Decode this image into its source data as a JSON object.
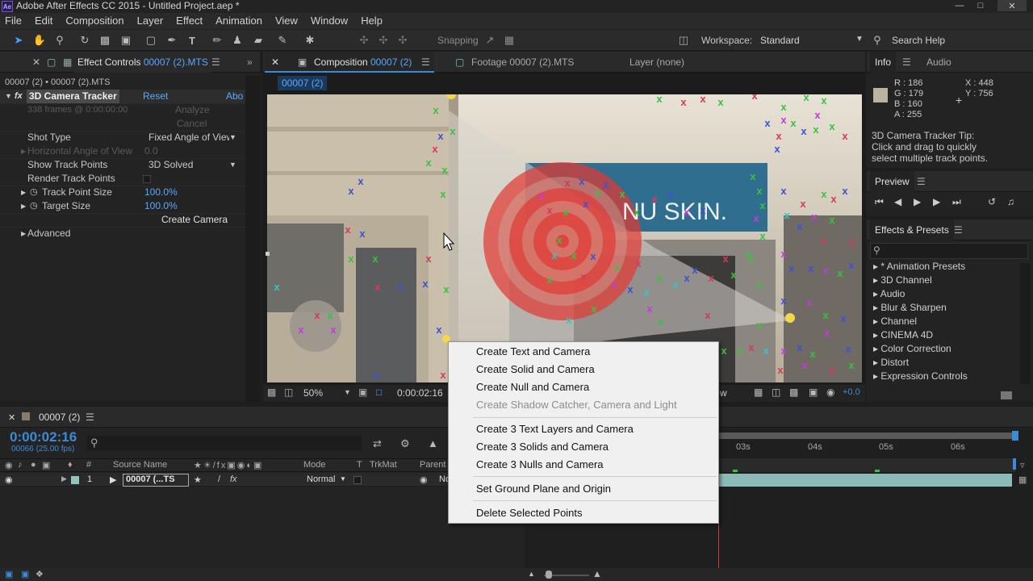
{
  "app": {
    "title": "Adobe After Effects CC 2015 - Untitled Project.aep *",
    "icon_text": "Ae"
  },
  "menu": [
    "File",
    "Edit",
    "Composition",
    "Layer",
    "Effect",
    "Animation",
    "View",
    "Window",
    "Help"
  ],
  "toolbar": {
    "snapping_label": "Snapping",
    "workspace_label": "Workspace:",
    "workspace_value": "Standard",
    "search_placeholder": "Search Help"
  },
  "effect_controls": {
    "tab_label": "Effect Controls",
    "tab_file": "00007 (2).MTS",
    "breadcrumb": "00007 (2) • 00007 (2).MTS",
    "effect_name": "3D Camera Tracker",
    "reset": "Reset",
    "about": "Abo",
    "frames_info": "338 frames @ 0:00:00:00",
    "analyze": "Analyze",
    "cancel": "Cancel",
    "shot_type_label": "Shot Type",
    "shot_type_value": "Fixed Angle of View",
    "hangle_label": "Horizontal Angle of View",
    "hangle_value": "0.0",
    "show_points_label": "Show Track Points",
    "show_points_value": "3D Solved",
    "render_points_label": "Render Track Points",
    "track_size_label": "Track Point Size",
    "track_size_value": "100.0%",
    "target_size_label": "Target Size",
    "target_size_value": "100.0%",
    "create_camera": "Create Camera",
    "advanced": "Advanced"
  },
  "composition": {
    "tab_label": "Composition",
    "tab_comp": "00007 (2)",
    "footage_tab": "Footage 00007 (2).MTS",
    "layer_tab": "Layer (none)",
    "comp_chip": "00007 (2)",
    "zoom": "50%",
    "timecode": "0:00:02:16",
    "view_partial": "w",
    "exposure": "+0.0"
  },
  "context_menu": [
    {
      "label": "Create Text and Camera",
      "enabled": true
    },
    {
      "label": "Create Solid and Camera",
      "enabled": true
    },
    {
      "label": "Create Null and Camera",
      "enabled": true
    },
    {
      "label": "Create Shadow Catcher, Camera and Light",
      "enabled": false
    },
    {
      "label": "Create 3 Text Layers and Camera",
      "enabled": true
    },
    {
      "label": "Create 3 Solids and Camera",
      "enabled": true
    },
    {
      "label": "Create 3 Nulls and Camera",
      "enabled": true
    },
    {
      "label": "Set Ground Plane and Origin",
      "enabled": true
    },
    {
      "label": "Delete Selected Points",
      "enabled": true
    }
  ],
  "info": {
    "tab": "Info",
    "audio_tab": "Audio",
    "r": "R : 186",
    "g": "G : 179",
    "b": "B : 160",
    "a": "A : 255",
    "x": "X : 448",
    "y": "Y : 756",
    "swatch": "#bab3a0",
    "tip_title": "3D Camera Tracker Tip:",
    "tip_line1": "Click and drag to quickly",
    "tip_line2": "select multiple track points."
  },
  "preview": {
    "title": "Preview"
  },
  "effects_presets": {
    "title": "Effects & Presets",
    "items": [
      "* Animation Presets",
      "3D Channel",
      "Audio",
      "Blur & Sharpen",
      "Channel",
      "CINEMA 4D",
      "Color Correction",
      "Distort",
      "Expression Controls"
    ]
  },
  "timeline": {
    "tab": "00007 (2)",
    "timecode": "0:00:02:16",
    "frames": "00066 (25.00 fps)",
    "col_source": "Source Name",
    "col_mode": "Mode",
    "col_t": "T",
    "col_trkmat": "TrkMat",
    "col_parent": "Parent",
    "layer_num": "1",
    "layer_name": "00007 (...TS",
    "layer_mode": "Normal",
    "parent_partial": "No",
    "ruler": [
      "03s",
      "04s",
      "05s",
      "06s"
    ]
  }
}
